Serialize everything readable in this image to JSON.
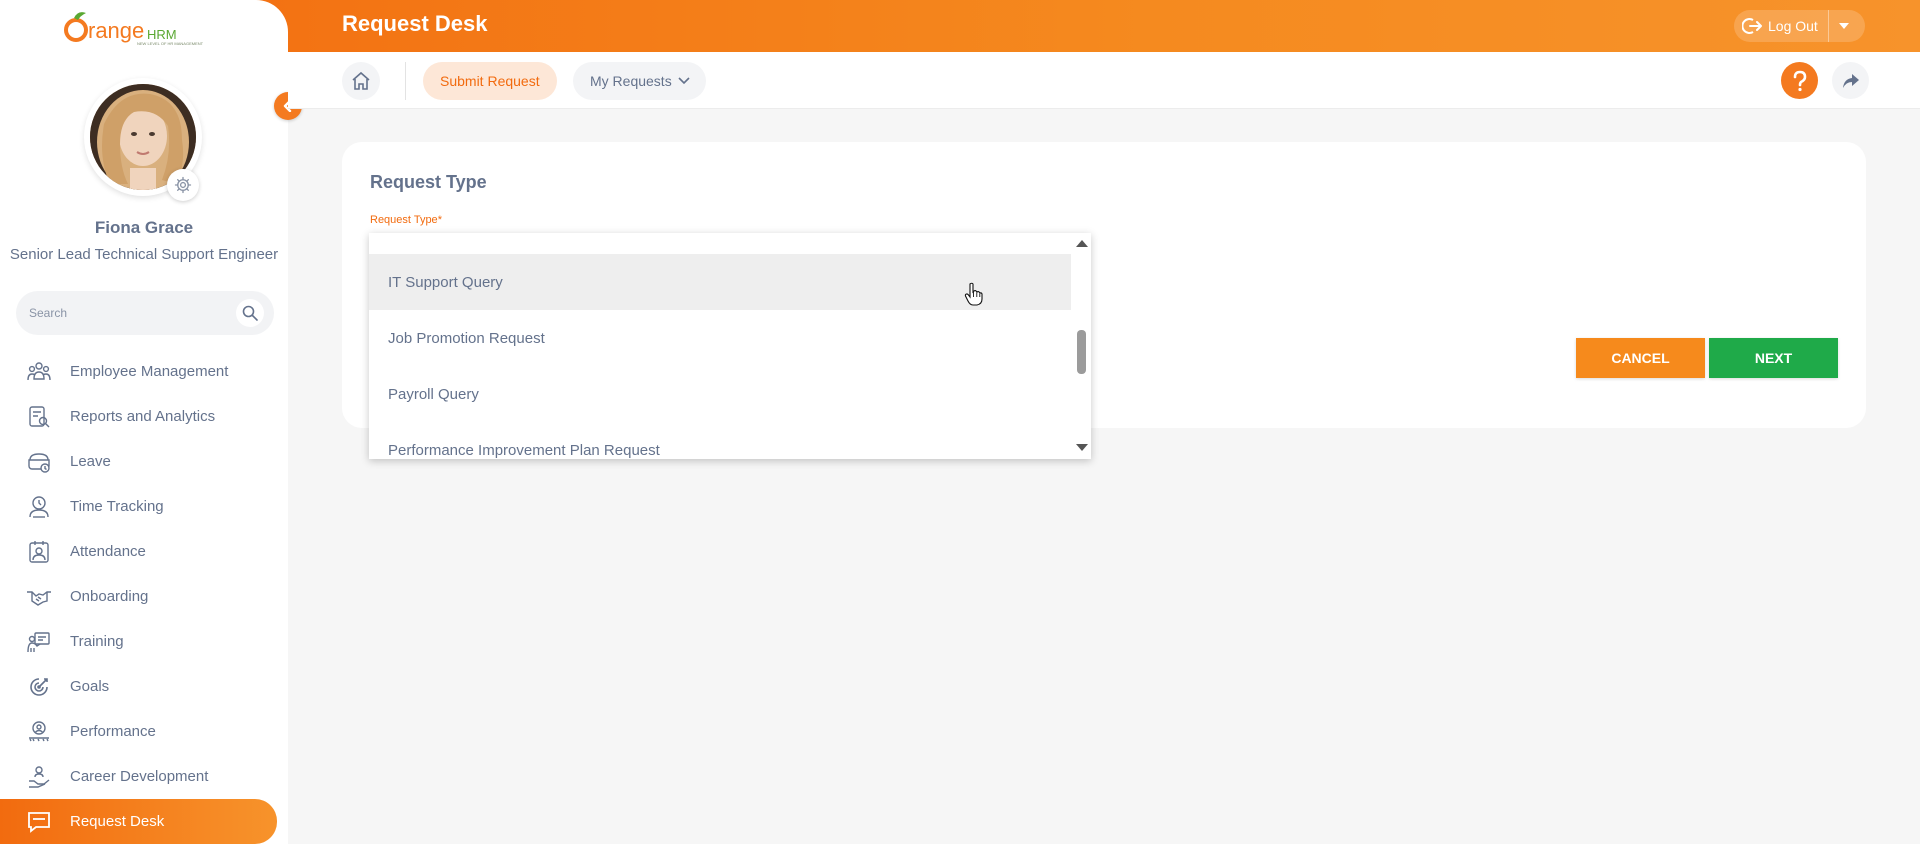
{
  "app": {
    "page_title": "Request Desk",
    "logo": {
      "brand_orange": "Orange",
      "brand_green": "HRM",
      "tagline": "NEW LEVEL OF HR MANAGEMENT"
    }
  },
  "topbar": {
    "logout_label": "Log Out",
    "logout_icon": "logout-icon",
    "menu_icon": "caret-down-icon"
  },
  "user": {
    "name": "Fiona Grace",
    "title": "Senior Lead Technical Support Engineer"
  },
  "search": {
    "placeholder": "Search"
  },
  "sidebar": {
    "items": [
      {
        "label": "Employee Management",
        "icon": "people-group-icon"
      },
      {
        "label": "Reports and Analytics",
        "icon": "report-search-icon"
      },
      {
        "label": "Leave",
        "icon": "leave-icon"
      },
      {
        "label": "Time Tracking",
        "icon": "time-tracking-icon"
      },
      {
        "label": "Attendance",
        "icon": "attendance-icon"
      },
      {
        "label": "Onboarding",
        "icon": "handshake-icon"
      },
      {
        "label": "Training",
        "icon": "training-icon"
      },
      {
        "label": "Goals",
        "icon": "goals-icon"
      },
      {
        "label": "Performance",
        "icon": "performance-icon"
      },
      {
        "label": "Career Development",
        "icon": "career-icon"
      },
      {
        "label": "Request Desk",
        "icon": "request-desk-icon",
        "active": true
      }
    ]
  },
  "subnav": {
    "home_icon": "home-icon",
    "tabs": [
      {
        "label": "Submit Request",
        "active": true
      },
      {
        "label": "My Requests",
        "has_dropdown": true
      }
    ],
    "help_icon": "help-icon",
    "share_icon": "share-icon"
  },
  "form": {
    "title": "Request Type",
    "field_label": "Request Type",
    "required_mark": "*",
    "options": [
      "IT Support Query",
      "Job Promotion Request",
      "Payroll Query",
      "Performance Improvement Plan Request"
    ],
    "hovered_option": "IT Support Query",
    "cancel_label": "CANCEL",
    "next_label": "NEXT"
  },
  "colors": {
    "accent_orange": "#f26b0f",
    "accent_green": "#1faa49",
    "text_slate": "#64728c"
  }
}
